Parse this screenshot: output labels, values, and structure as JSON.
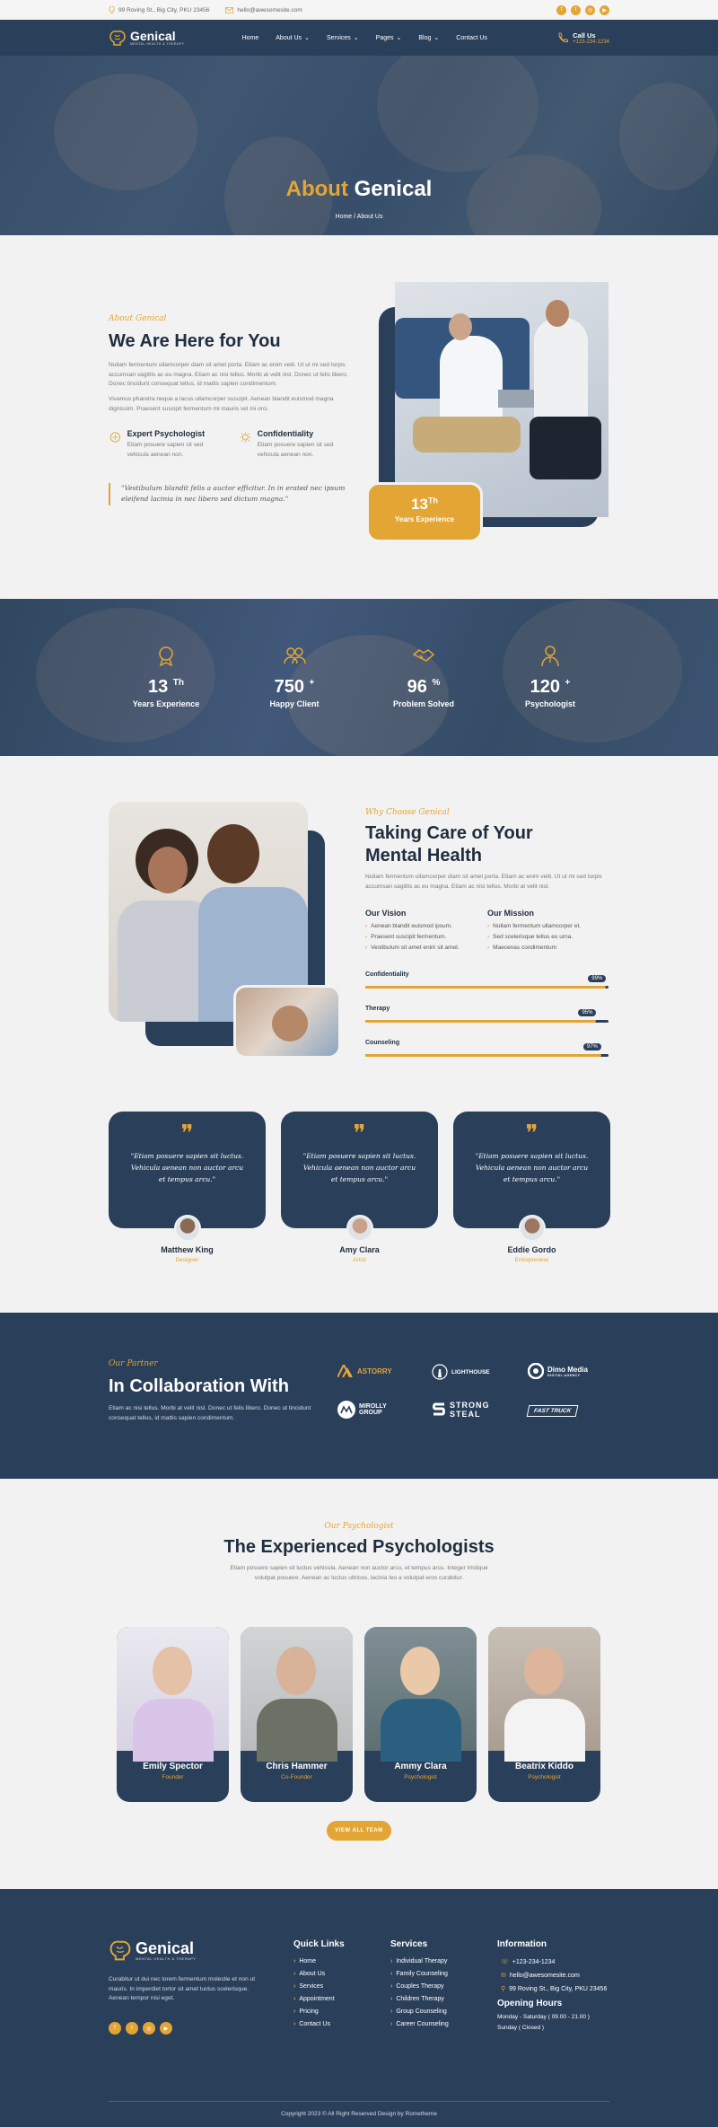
{
  "topbar": {
    "address": "99 Roving St., Big City, PKU 23456",
    "email": "hello@awesomesite.com"
  },
  "brand": {
    "name": "Genical",
    "tagline": "MENTAL HEALTH & THERAPY"
  },
  "nav": {
    "items": [
      {
        "label": "Home",
        "dropdown": false
      },
      {
        "label": "About Us",
        "dropdown": true
      },
      {
        "label": "Services",
        "dropdown": true
      },
      {
        "label": "Pages",
        "dropdown": true
      },
      {
        "label": "Blog",
        "dropdown": true
      },
      {
        "label": "Contact Us",
        "dropdown": false
      }
    ],
    "call_label": "Call Us",
    "call_number": "+123-234-1234"
  },
  "hero": {
    "title_accent": "About",
    "title_rest": "Genical",
    "breadcrumb": "Home / About Us"
  },
  "about": {
    "kicker": "About Genical",
    "title": "We Are Here for You",
    "para1": "Nullam fermentum ullamcorper diam sit amet porta. Etiam ac enim velit. Ut ut mi sed turpis accumsan sagittis ac eu magna. Etiam ac nisi tellus. Morbi at velit nisl. Donec ut felis libero. Donec tincidunt consequat tellus, id mattis sapien condimentum.",
    "para2": "Vivamus pharetra neque a lacus ullamcorper suscipit. Aenean blandit euismod magna dignissim. Praesent suscipit fermentum mi mauris vel mi orci.",
    "features": [
      {
        "title": "Expert Psychologist",
        "text": "Etiam posuere sapien sit sed vehicula aenean non."
      },
      {
        "title": "Confidentiality",
        "text": "Etiam posuere sapien sit sed vehicula aenean non."
      }
    ],
    "quote": "\"Vestibulum blandit felis a auctor efficitur. In in erated nec ipsum eleifend lacinia in nec libero sed dictum magna.\"",
    "badge_number": "13",
    "badge_sup": "Th",
    "badge_label": "Years Experience"
  },
  "stats": [
    {
      "number": "13",
      "suffix": "Th",
      "label": "Years Experience"
    },
    {
      "number": "750",
      "suffix": "+",
      "label": "Happy Client"
    },
    {
      "number": "96",
      "suffix": "%",
      "label": "Problem Solved"
    },
    {
      "number": "120",
      "suffix": "+",
      "label": "Psychologist"
    }
  ],
  "why": {
    "kicker": "Why Choose Genical",
    "title_line1": "Taking Care of Your",
    "title_line2": "Mental Health",
    "para": "Nullam fermentum ullamcorper diam sit amet porta. Etiam ac enim velit. Ut ut mi sed turpis accumsan sagittis ac eu magna. Etiam ac nisi tellus. Morbi at velit nisl.",
    "vision_title": "Our Vision",
    "vision_items": [
      "Aenean blandit euismod ipsum.",
      "Praesent suscipit fermentum.",
      "Vestibulum sit amet enim sit amet."
    ],
    "mission_title": "Our Mission",
    "mission_items": [
      "Nullam fermentum ullamcorper et.",
      "Sed scelerisque tellus eu urna.",
      "Maecenas condimentum"
    ],
    "skills": [
      {
        "label": "Confidentiality",
        "value": "99%",
        "percent": 99
      },
      {
        "label": "Therapy",
        "value": "95%",
        "percent": 95
      },
      {
        "label": "Counseling",
        "value": "97%",
        "percent": 97
      }
    ]
  },
  "testimonials": [
    {
      "quote": "\"Etiam posuere sapien sit luctus. Vehicula aenean non auctor arcu et tempus arcu.\"",
      "name": "Matthew King",
      "role": "Designer"
    },
    {
      "quote": "\"Etiam posuere sapien sit luctus. Vehicula aenean non auctor arcu et tempus arcu.\"",
      "name": "Amy Clara",
      "role": "Artist"
    },
    {
      "quote": "\"Etiam posuere sapien sit luctus. Vehicula aenean non auctor arcu et tempus arcu.\"",
      "name": "Eddie Gordo",
      "role": "Entrepreneur"
    }
  ],
  "partners": {
    "kicker": "Our Partner",
    "title": "In Collaboration With",
    "para": "Etiam ac nisi tellus. Morbi at velit nisl. Donec ut felis libero. Donec ut tincidunt consequat tellus, id mattis sapien condimentum.",
    "logos": [
      {
        "name": "ASTORRY",
        "sub": ""
      },
      {
        "name": "LIGHTHOUSE",
        "sub": ""
      },
      {
        "name": "Dimo Media",
        "sub": "DIGITAL AGENCY"
      },
      {
        "name": "MIROLLY",
        "sub": "GROUP"
      },
      {
        "name": "STRONG",
        "sub": "STEAL"
      },
      {
        "name": "FAST TRUCK",
        "sub": ""
      }
    ]
  },
  "team": {
    "kicker": "Our Psychologist",
    "title": "The Experienced Psychologists",
    "para": "Etiam posuere sapien sit luctus vehicula. Aenean non auctor arcu, et tempus arcu. Integer tristique volutpat posuere. Aenean ac luctus ultrices, lacinia leo a volutpat eros curabitur.",
    "members": [
      {
        "name": "Emily Spector",
        "role": "Founder"
      },
      {
        "name": "Chris Hammer",
        "role": "Co-Founder"
      },
      {
        "name": "Ammy Clara",
        "role": "Psychologist"
      },
      {
        "name": "Beatrix Kiddo",
        "role": "Psychologist"
      }
    ],
    "button": "VIEW ALL TEAM"
  },
  "footer": {
    "about": "Curabitur ut dui nec lorem fermentum molestie et non ut mauris. In imperdiet tortor sit amet luctus scelerisque. Aenean tempor nisi eget.",
    "quick_title": "Quick Links",
    "quick_links": [
      "Home",
      "About Us",
      "Services",
      "Appointment",
      "Pricing",
      "Contact Us"
    ],
    "services_title": "Services",
    "services": [
      "Individual Therapy",
      "Family Counseling",
      "Couples Therapy",
      "Children Therapy",
      "Group Counseling",
      "Career Counseling"
    ],
    "info_title": "Information",
    "phone": "+123-234-1234",
    "email": "hello@awesomesite.com",
    "address": "99 Roving St., Big City, PKU 23456",
    "hours_title": "Opening Hours",
    "hours1": "Monday - Saturday ( 09.00 - 21.00 )",
    "hours2": "Sunday ( Closed )",
    "copyright": "Copyright 2023 © All Right Reserved Design by Rometheme"
  },
  "colors": {
    "navy": "#2a3f5a",
    "gold": "#e3a534",
    "bg": "#f2f2f2"
  },
  "icons": [
    "map-pin-icon",
    "mail-icon",
    "facebook-icon",
    "twitter-icon",
    "instagram-icon",
    "youtube-icon",
    "phone-icon",
    "quote-icon",
    "brain-icon"
  ]
}
